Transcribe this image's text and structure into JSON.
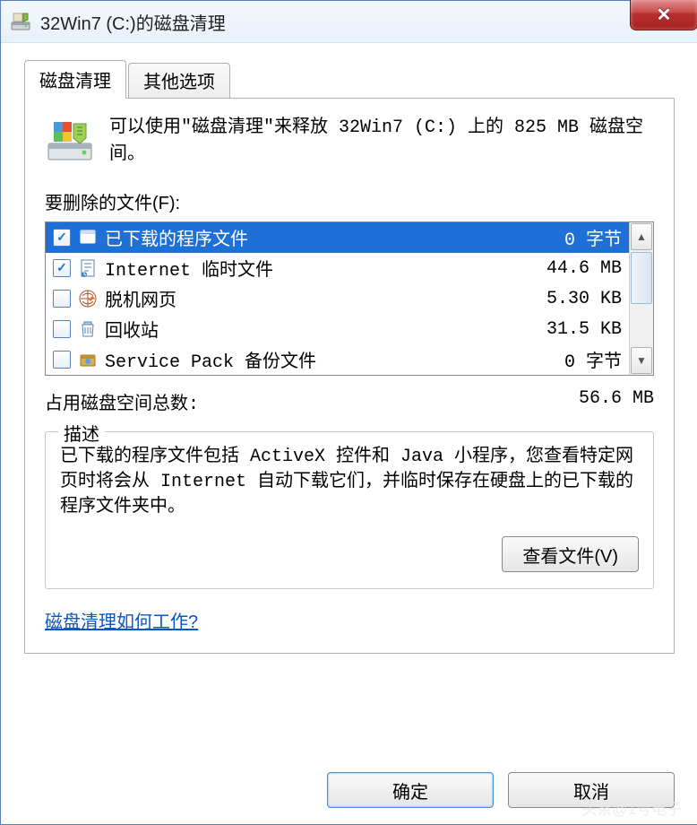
{
  "title": "32Win7 (C:)的磁盘清理",
  "tabs": {
    "cleanup": "磁盘清理",
    "more": "其他选项"
  },
  "intro": "可以使用\"磁盘清理\"来释放 32Win7  (C:) 上的 825 MB 磁盘空间。",
  "files_label": "要删除的文件(F):",
  "files": [
    {
      "name": "已下载的程序文件",
      "size": "0 字节",
      "checked": true,
      "selected": true
    },
    {
      "name": "Internet 临时文件",
      "size": "44.6 MB",
      "checked": true,
      "selected": false
    },
    {
      "name": "脱机网页",
      "size": "5.30 KB",
      "checked": false,
      "selected": false
    },
    {
      "name": "回收站",
      "size": "31.5 KB",
      "checked": false,
      "selected": false
    },
    {
      "name": "Service Pack 备份文件",
      "size": "0 字节",
      "checked": false,
      "selected": false
    }
  ],
  "total_label": "占用磁盘空间总数:",
  "total_value": "56.6 MB",
  "desc_legend": "描述",
  "desc_text": "已下载的程序文件包括 ActiveX 控件和 Java 小程序，您查看特定网页时将会从 Internet 自动下载它们，并临时保存在硬盘上的已下载的程序文件夹中。",
  "view_files_btn": "查看文件(V)",
  "help_link": "磁盘清理如何工作?",
  "ok_btn": "确定",
  "cancel_btn": "取消",
  "watermark": "头条@1号电子"
}
